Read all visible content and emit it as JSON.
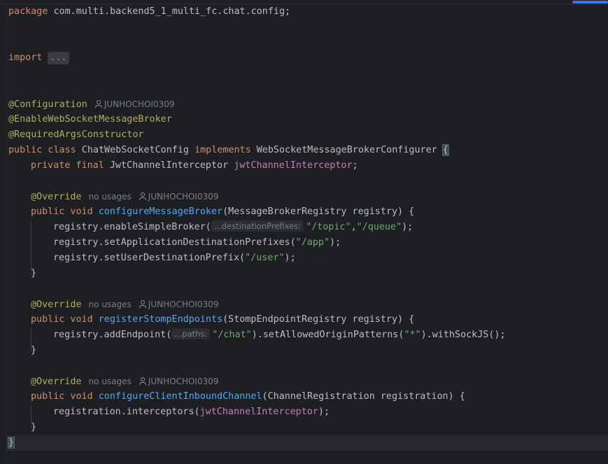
{
  "editor": {
    "package_kw": "package",
    "package_name": " com.multi.backend5_1_multi_fc.chat.config;",
    "import_kw": "import",
    "import_fold": "...",
    "annotations": {
      "configuration": "@Configuration",
      "enable_ws": "@EnableWebSocketMessageBroker",
      "required_args": "@RequiredArgsConstructor",
      "override": "@Override"
    },
    "author": "JUNHOCHOI0309",
    "no_usages": "no usages",
    "class_decl": {
      "public": "public",
      "class": " class",
      "name": " ChatWebSocketConfig ",
      "implements": "implements",
      "iface": " WebSocketMessageBrokerConfigurer ",
      "open_brace": "{"
    },
    "field": {
      "private": "private",
      "final": " final",
      "type": " JwtChannelInterceptor ",
      "name": "jwtChannelInterceptor",
      "semi": ";"
    },
    "method1": {
      "mods": "public void",
      "name": "configureMessageBroker",
      "params": "(MessageBrokerRegistry registry) {",
      "line1_pre": "registry.enableSimpleBroker(",
      "line1_hint": "...destinationPrefixes:",
      "line1_s1": "\"/topic\"",
      "line1_comma": ",",
      "line1_s2": "\"/queue\"",
      "line1_post": ");",
      "line2_pre": "registry.setApplicationDestinationPrefixes(",
      "line2_s": "\"/app\"",
      "line2_post": ");",
      "line3_pre": "registry.setUserDestinationPrefix(",
      "line3_s": "\"/user\"",
      "line3_post": ");",
      "close": "}"
    },
    "method2": {
      "mods": "public void",
      "name": "registerStompEndpoints",
      "params": "(StompEndpointRegistry registry) {",
      "line1_pre": "registry.addEndpoint(",
      "line1_hint": "...paths:",
      "line1_s1": "\"/chat\"",
      "line1_mid": ").setAllowedOriginPatterns(",
      "line1_s2": "\"*\"",
      "line1_post": ").withSockJS();",
      "close": "}"
    },
    "method3": {
      "mods": "public void",
      "name": "configureClientInboundChannel",
      "params": "(ChannelRegistration registration) {",
      "line1_pre": "registration.interceptors(",
      "line1_field": "jwtChannelInterceptor",
      "line1_post": ");",
      "close": "}"
    },
    "class_close": "}"
  }
}
